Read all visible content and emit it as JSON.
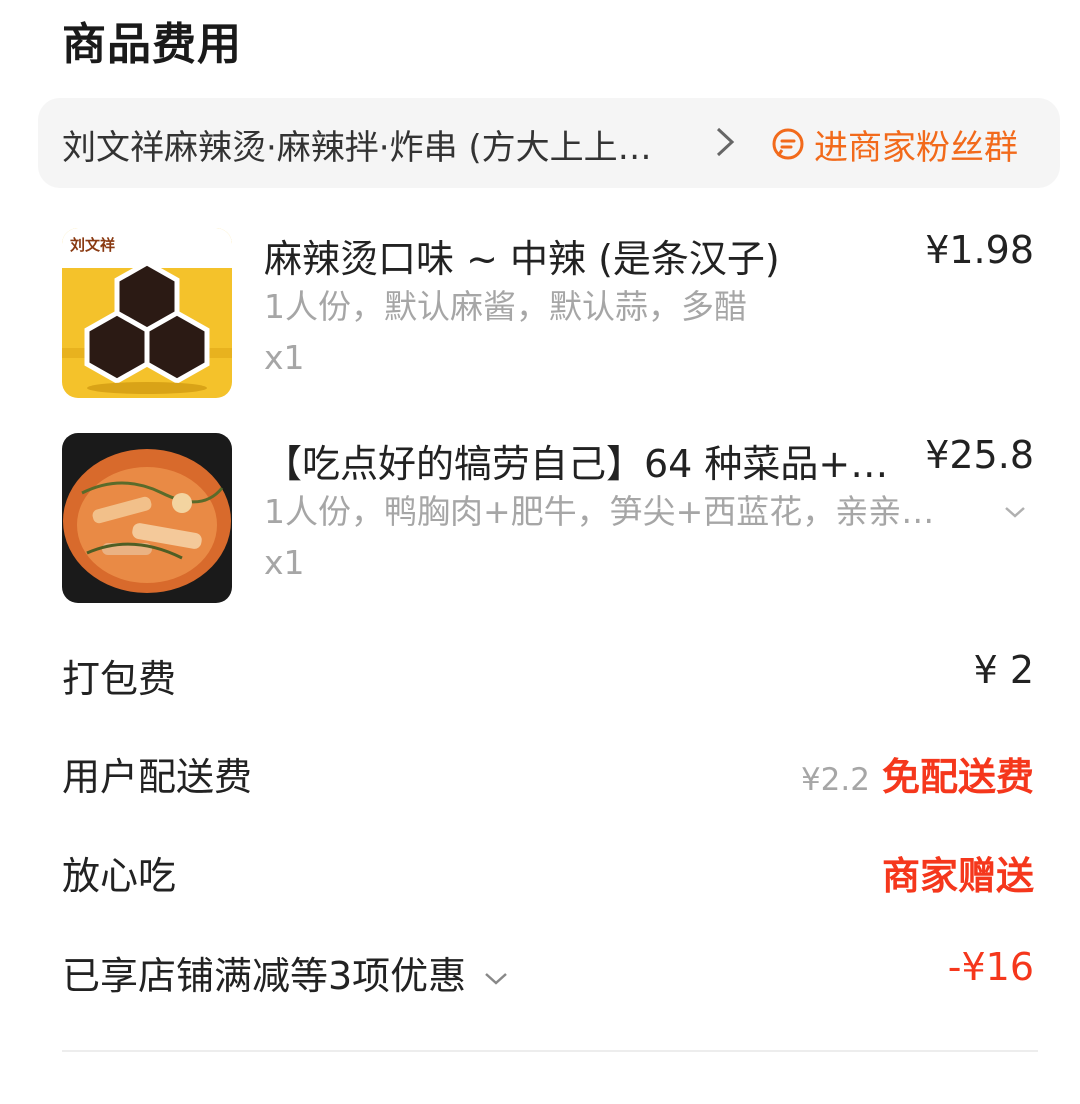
{
  "section_title": "商品费用",
  "store": {
    "name": "刘文祥麻辣烫·麻辣拌·炸串 (方大上上…",
    "fan_group_label": "进商家粉丝群",
    "icons": {
      "chevron": "chevron-right-icon",
      "fan_group": "chat-bubble-icon"
    }
  },
  "items": [
    {
      "name": "麻辣烫口味 ~ 中辣 (是条汉子)",
      "price": "¥1.98",
      "spec": "1人份，默认麻酱，默认蒜，多醋",
      "qty": "x1",
      "image_logo_text": "刘文祥"
    },
    {
      "name": "【吃点好的犒劳自己】64 种菜品+…",
      "price": "¥25.8",
      "spec": "1人份，鸭胸肉+肥牛，笋尖+西蓝花，亲亲…",
      "qty": "x1"
    }
  ],
  "fees": {
    "packing": {
      "label": "打包费",
      "value": "¥ 2"
    },
    "delivery": {
      "label": "用户配送费",
      "original": "¥2.2",
      "value": "免配送费"
    },
    "worry_free": {
      "label": "放心吃",
      "value": "商家赠送"
    },
    "discount": {
      "label": "已享店铺满减等3项优惠",
      "value": "-¥16"
    }
  },
  "colors": {
    "accent_orange": "#f26a1b",
    "accent_red": "#f5371c",
    "muted_gray": "#a6a6a6"
  }
}
